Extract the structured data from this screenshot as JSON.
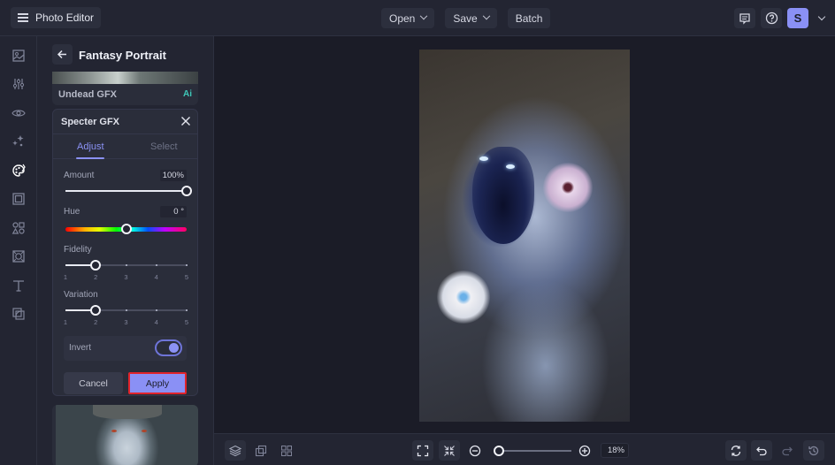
{
  "app": {
    "title": "Photo Editor",
    "menu_icon": "hamburger-icon"
  },
  "toolbar": {
    "open_label": "Open",
    "save_label": "Save",
    "batch_label": "Batch",
    "feedback_icon": "message-icon",
    "help_icon": "help-circle-icon",
    "avatar_initial": "S",
    "accent_color": "#8a90f5"
  },
  "rail": {
    "items": [
      {
        "name": "image",
        "icon": "image-icon"
      },
      {
        "name": "adjustments",
        "icon": "sliders-icon"
      },
      {
        "name": "preview",
        "icon": "eye-icon"
      },
      {
        "name": "ai-tools",
        "icon": "sparkles-icon"
      },
      {
        "name": "effects",
        "icon": "palette-icon",
        "active": true
      },
      {
        "name": "frames",
        "icon": "frame-icon"
      },
      {
        "name": "graphics",
        "icon": "shapes-icon"
      },
      {
        "name": "textures",
        "icon": "texture-icon"
      },
      {
        "name": "text",
        "icon": "text-icon"
      },
      {
        "name": "overlays",
        "icon": "overlay-icon"
      }
    ]
  },
  "panel": {
    "title": "Fantasy Portrait",
    "prev_effect": {
      "label": "Undead GFX",
      "badge": "Ai"
    },
    "effect": {
      "title": "Specter GFX",
      "tabs": [
        {
          "label": "Adjust",
          "active": true
        },
        {
          "label": "Select",
          "active": false
        }
      ],
      "amount": {
        "label": "Amount",
        "value_text": "100%",
        "value": 100,
        "min": 0,
        "max": 100
      },
      "hue": {
        "label": "Hue",
        "value_text": "0 °",
        "value": 0,
        "min": -180,
        "max": 180
      },
      "fidelity": {
        "label": "Fidelity",
        "value": 2,
        "steps": [
          "1",
          "2",
          "3",
          "4",
          "5"
        ]
      },
      "variation": {
        "label": "Variation",
        "value": 2,
        "steps": [
          "1",
          "2",
          "3",
          "4",
          "5"
        ]
      },
      "invert": {
        "label": "Invert",
        "on": true
      },
      "cancel_label": "Cancel",
      "apply_label": "Apply"
    }
  },
  "canvas": {
    "zoom_text": "18%",
    "zoom_fraction": 0.05
  },
  "bottombar": {
    "left_icons": [
      "layers-icon",
      "duplicate-icon",
      "grid-icon"
    ],
    "fit_icon": "fit-screen-icon",
    "actual_size_icon": "shrink-icon",
    "zoom_out_icon": "zoom-out-icon",
    "zoom_in_icon": "zoom-in-icon",
    "right_icons": [
      "compare-icon",
      "undo-icon",
      "redo-icon",
      "history-icon"
    ]
  }
}
